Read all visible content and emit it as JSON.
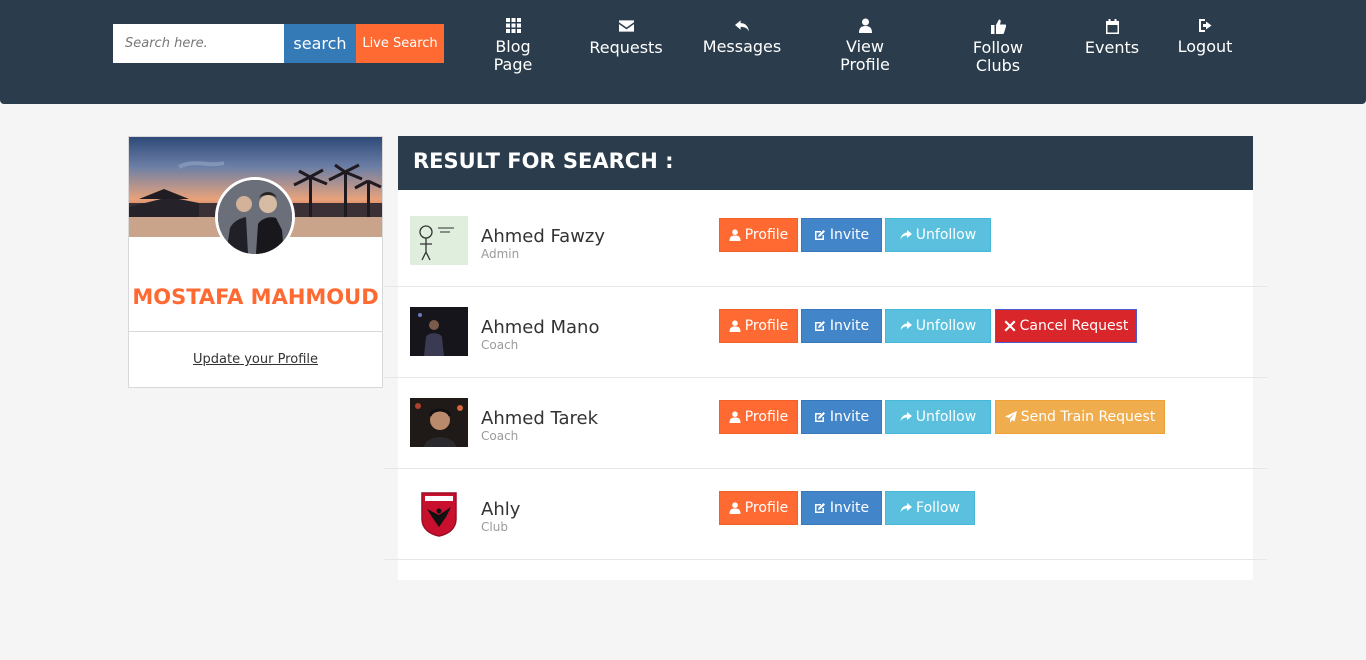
{
  "header": {
    "search_placeholder": "Search here.",
    "search_button": "search",
    "live_search_button": "Live Search",
    "nav": [
      {
        "label": "Blog\nPage",
        "icon": "grid-icon"
      },
      {
        "label": "Requests",
        "icon": "envelope-icon"
      },
      {
        "label": "Messages",
        "icon": "reply-icon"
      },
      {
        "label": "View\nProfile",
        "icon": "user-icon"
      },
      {
        "label": "Follow\nClubs",
        "icon": "thumbs-up-icon"
      },
      {
        "label": "Events",
        "icon": "calendar-icon"
      },
      {
        "label": "Logout",
        "icon": "logout-icon"
      }
    ]
  },
  "profile": {
    "name": "MOSTAFA MAHMOUD",
    "update_link": "Update your Profile"
  },
  "results": {
    "title": "RESULT FOR SEARCH :",
    "items": [
      {
        "name": "Ahmed Fawzy",
        "role": "Admin",
        "actions": [
          "Profile",
          "Invite",
          "Unfollow"
        ]
      },
      {
        "name": "Ahmed Mano",
        "role": "Coach",
        "actions": [
          "Profile",
          "Invite",
          "Unfollow",
          "Cancel Request"
        ]
      },
      {
        "name": "Ahmed Tarek",
        "role": "Coach",
        "actions": [
          "Profile",
          "Invite",
          "Unfollow",
          "Send Train Request"
        ]
      },
      {
        "name": "Ahly",
        "role": "Club",
        "actions": [
          "Profile",
          "Invite",
          "Follow"
        ]
      }
    ]
  },
  "colors": {
    "navbar": "#2b3d4c",
    "accent_orange": "#ff6a33",
    "primary_blue": "#337ab7",
    "info": "#5bc0de",
    "danger": "#d9262b",
    "warning": "#f0ad4e"
  }
}
